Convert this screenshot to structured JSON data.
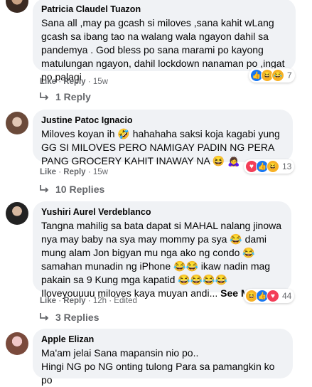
{
  "comments": [
    {
      "name": "Patricia Claudel Tuazon",
      "text": "Sana all ,may pa gcash si miloves ,sana kahit wLang gcash sa ibang tao na walang wala ngayon dahil sa pandemya . God bless po sana marami po kayong matulungan ngayon, dahil lockdown nanaman po ,ingat po palagi",
      "like": "Like",
      "reply": "Reply",
      "time": "15w",
      "reaction_count": "7",
      "replies": "1 Reply"
    },
    {
      "name": "Justine Patoc Ignacio",
      "text": "Miloves koyan ih 🤣 hahahaha saksi koja kagabi yung GG SI MILOVES PERO NAMIGAY PADIN NG PERA PANG GROCERY KAHIT INAWAY NA 😆 🙇‍♀️",
      "like": "Like",
      "reply": "Reply",
      "time": "15w",
      "reaction_count": "13",
      "replies": "10 Replies"
    },
    {
      "name": "Yushiri Aurel Verdeblanco",
      "text": "Tangna mahilig sa bata dapat si MAHAL nalang jinowa nya may baby na sya may mommy pa sya 😂 dami mung alam Jon bigyan mu nga ako ng condo 😂 samahan munadin ng iPhone 😂😂 ikaw nadin mag pakain sa 9 Kung mga kapatid 😂😂😂😂 Iloveyouuuu miloves kaya muyan andi...",
      "see_more": "See More",
      "like": "Like",
      "reply": "Reply",
      "time": "12h",
      "edited": "Edited",
      "reaction_count": "44",
      "replies": "3 Replies"
    },
    {
      "name": "Apple Elizan",
      "text": "Ma'am jelai Sana mapansin nio po..\nHingi NG po NG onting tulong Para sa pamangkin ko po"
    }
  ],
  "separator": "·",
  "colors": {
    "bubble": "#f0f2f5",
    "meta": "#65676b",
    "like": "#1877f2",
    "love": "#f33e58",
    "haha": "#f7b125"
  }
}
